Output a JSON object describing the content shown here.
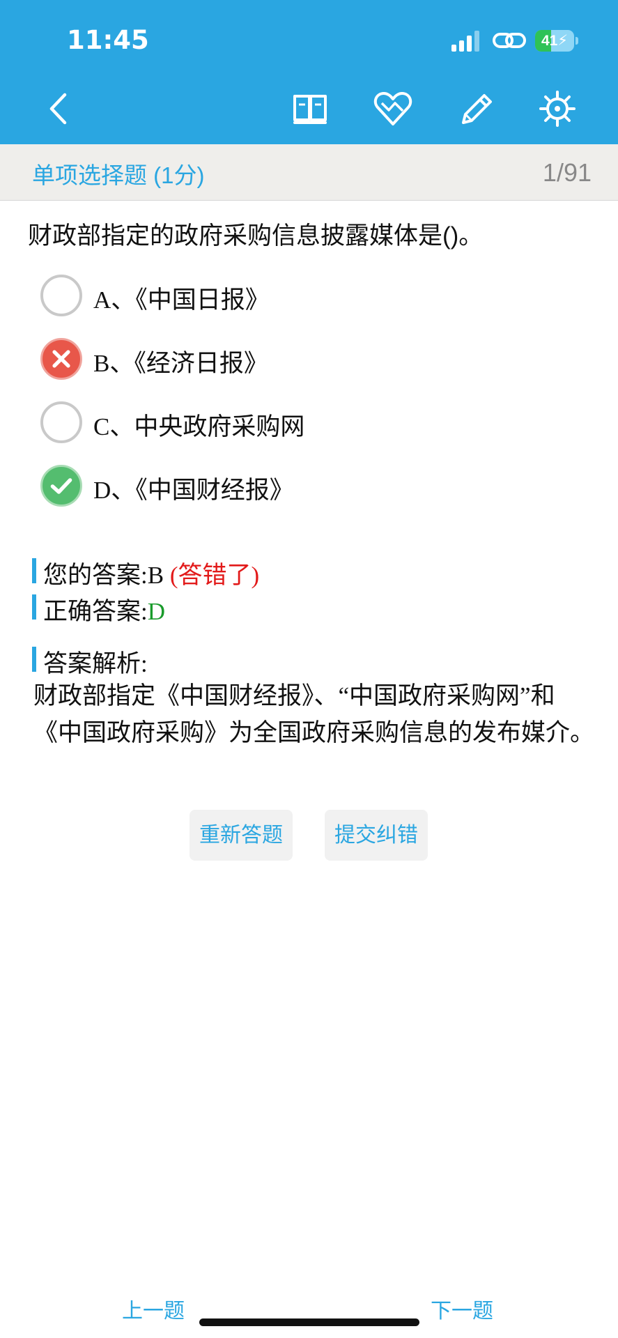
{
  "status_bar": {
    "time": "11:45",
    "battery_level": "41",
    "battery_fraction": 0.41
  },
  "nav_icons": [
    "back-icon",
    "book-icon",
    "heart-icon",
    "pencil-icon",
    "gear-icon"
  ],
  "titlebar": {
    "question_type": "单项选择题 (1分)",
    "counter": "1/91"
  },
  "question": {
    "text": "财政部指定的政府采购信息披露媒体是()。",
    "options": [
      {
        "label": "A、《中国日报》",
        "state": "empty"
      },
      {
        "label": "B、《经济日报》",
        "state": "wrong"
      },
      {
        "label": "C、中央政府采购网",
        "state": "empty"
      },
      {
        "label": "D、《中国财经报》",
        "state": "right"
      }
    ]
  },
  "answers": {
    "your_answer_label": "您的答案:",
    "your_answer_value": "B",
    "your_answer_status": "(答错了)",
    "correct_answer_label": "正确答案:",
    "correct_answer_value": "D",
    "analysis_label": "答案解析:",
    "analysis_text": "财政部指定《中国财经报》、“中国政府采购网”和《中国政府采购》为全国政府采购信息的发布媒介。"
  },
  "buttons": {
    "redo": "重新答题",
    "report": "提交纠错"
  },
  "bottom_nav": {
    "prev": "上一题",
    "next": "下一题"
  },
  "colors": {
    "accent": "#2aa6e1",
    "wrong": "#e8574a",
    "right": "#54bd6f",
    "wrong_text": "#e21a1a",
    "correct_text": "#1a9b2c"
  }
}
